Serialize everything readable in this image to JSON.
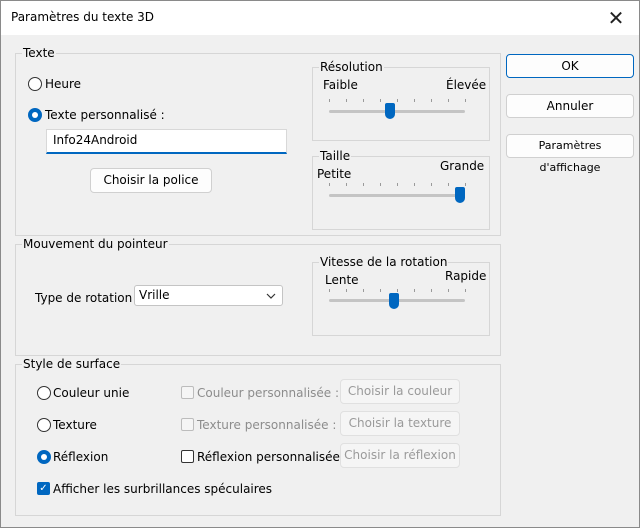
{
  "window": {
    "title": "Paramètres du texte 3D",
    "close_glyph": "✕"
  },
  "texte": {
    "group_label": "Texte",
    "radio_heure": "Heure",
    "radio_custom": "Texte personnalisé :",
    "text_value": "Info24Android",
    "choose_font": "Choisir la police",
    "resolution": {
      "label": "Résolution",
      "min_label": "Faible",
      "max_label": "Élevée",
      "value_percent": 50
    },
    "taille": {
      "label": "Taille",
      "min_label": "Petite",
      "max_label": "Grande",
      "value_percent": 100
    }
  },
  "pointeur": {
    "group_label": "Mouvement du pointeur",
    "rotation_label": "Type de rotation :",
    "rotation_value": "Vrille",
    "vitesse": {
      "label": "Vitesse de la rotation",
      "min_label": "Lente",
      "max_label": "Rapide",
      "value_percent": 50
    }
  },
  "surface": {
    "group_label": "Style de surface",
    "radio_color": "Couleur unie",
    "radio_texture": "Texture",
    "radio_reflexion": "Réflexion",
    "check_color": "Couleur personnalisée :",
    "check_texture": "Texture personnalisée :",
    "check_reflexion": "Réflexion personnalisée :",
    "btn_color": "Choisir la couleur",
    "btn_texture": "Choisir la texture",
    "btn_reflexion": "Choisir la réflexion",
    "check_specular": "Afficher les surbrillances spéculaires"
  },
  "buttons": {
    "ok": "OK",
    "cancel": "Annuler",
    "display": "Paramètres d'affichage"
  },
  "colors": {
    "accent": "#0067c0"
  }
}
